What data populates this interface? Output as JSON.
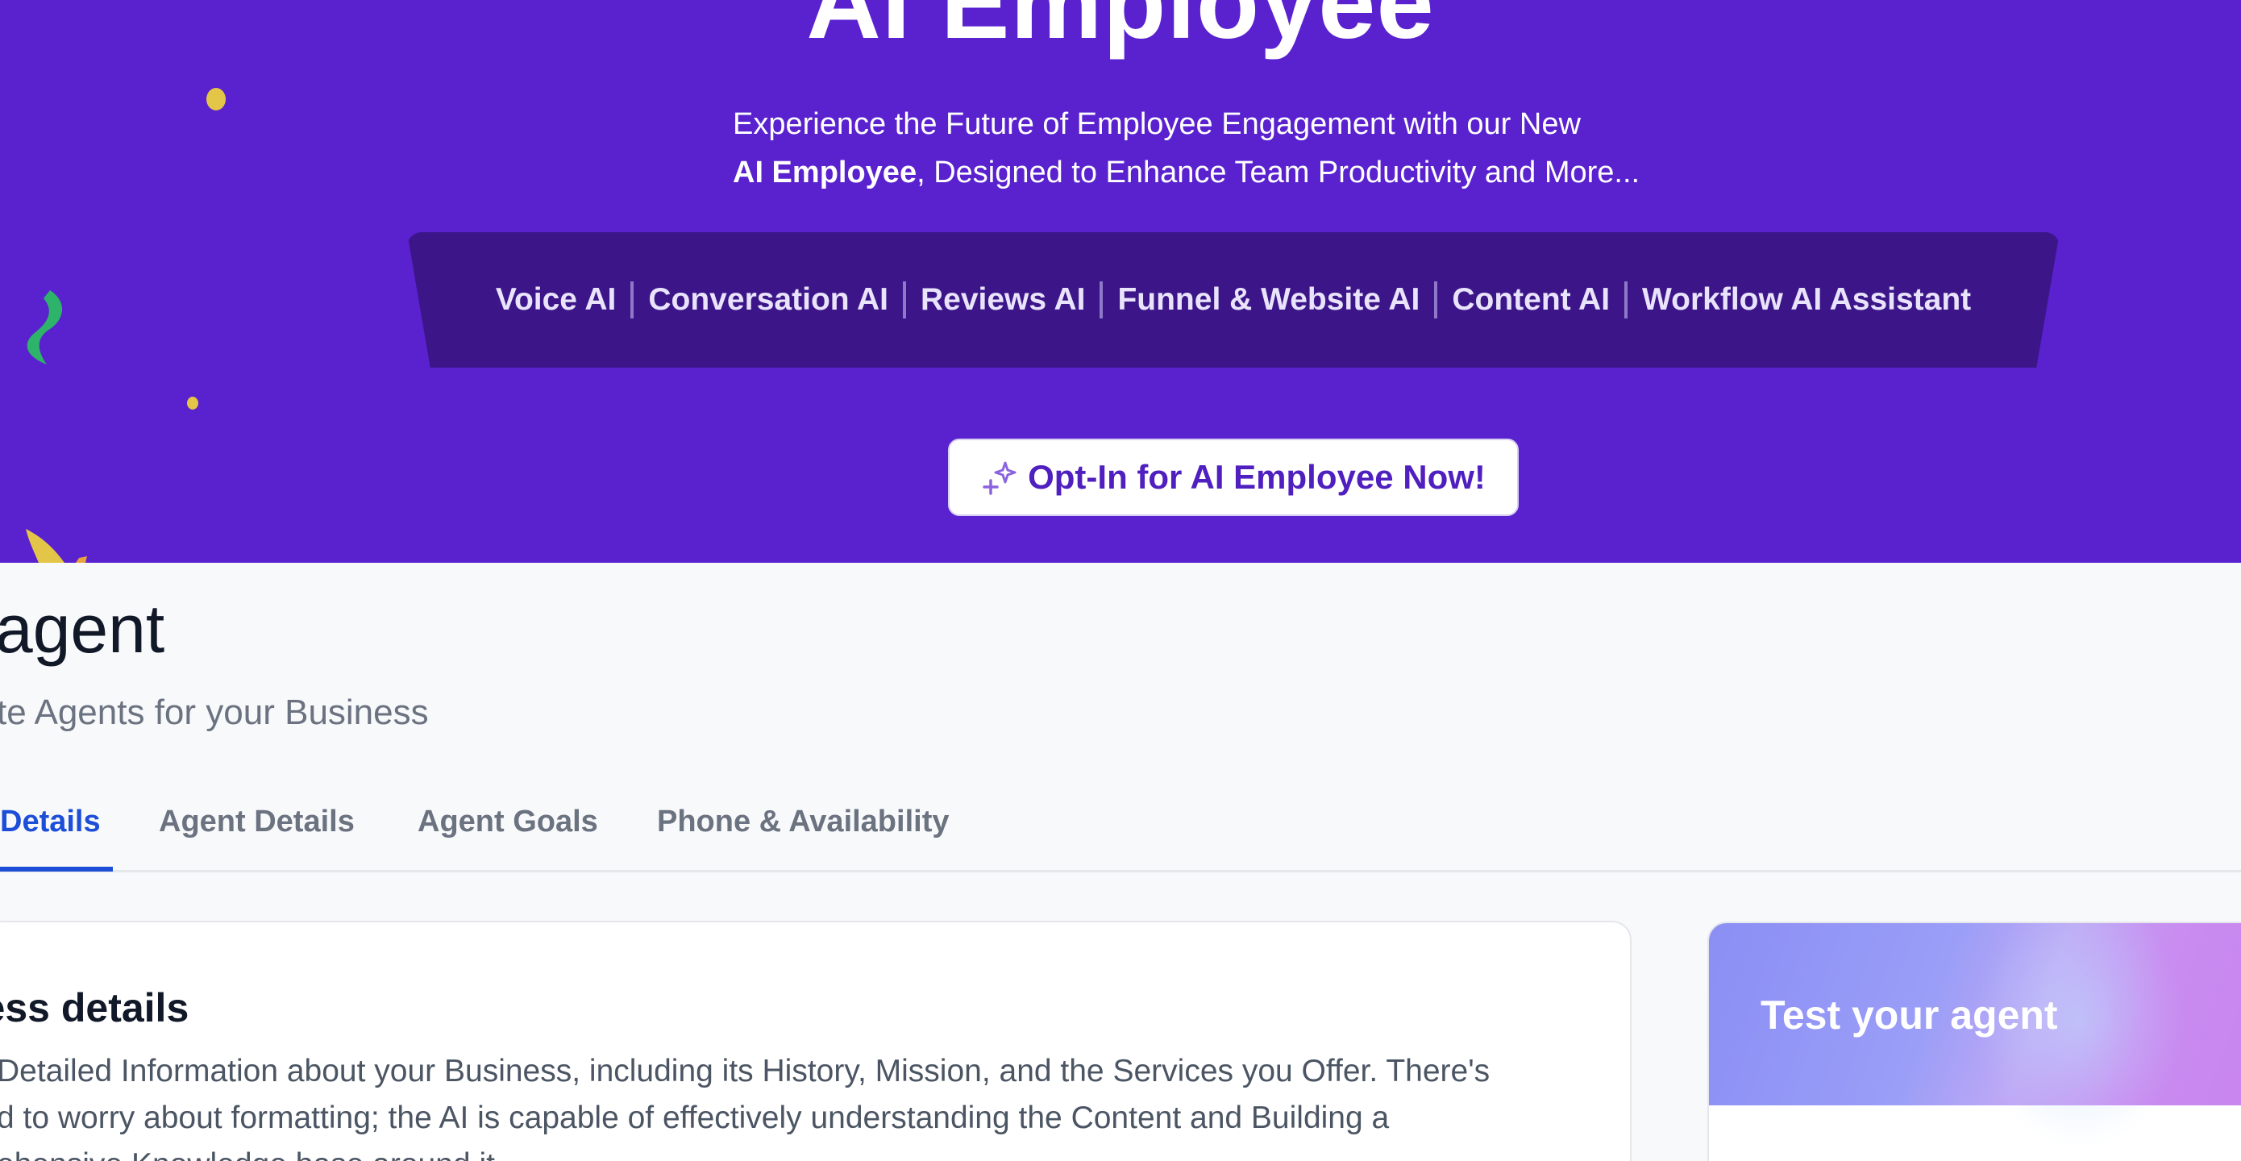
{
  "hero": {
    "title": "AI Employee",
    "subtitle_line1": "Experience the Future of Employee Engagement with our New",
    "subtitle_bold": "AI Employee",
    "subtitle_rest": ", Designed to Enhance Team Productivity and More...",
    "features": [
      "Voice AI",
      "Conversation AI",
      "Reviews AI",
      "Funnel & Website AI",
      "Content AI",
      "Workflow AI Assistant"
    ],
    "cta_label": "Opt-In for AI Employee Now!",
    "cta_icon": "sparkle-icon",
    "background_color": "#5a21cf",
    "feature_bar_color": "#3c1689"
  },
  "page": {
    "title": "agent",
    "subtitle": "te Agents for your Business"
  },
  "tabs": [
    {
      "label": "Details",
      "active": true
    },
    {
      "label": "Agent Details",
      "active": false
    },
    {
      "label": "Agent Goals",
      "active": false
    },
    {
      "label": "Phone & Availability",
      "active": false
    }
  ],
  "business_card": {
    "title": "ness details",
    "body_line1": "Detailed Information about your Business, including its History, Mission, and the Services you Offer. There's",
    "body_line2": "d to worry about formatting; the AI is capable of effectively understanding the Content and Building a",
    "body_line3": "ehensive Knowledge base around it."
  },
  "test_card": {
    "title": "Test your agent"
  },
  "colors": {
    "accent_blue": "#1d4ed8",
    "cta_text": "#4f1fbf"
  }
}
